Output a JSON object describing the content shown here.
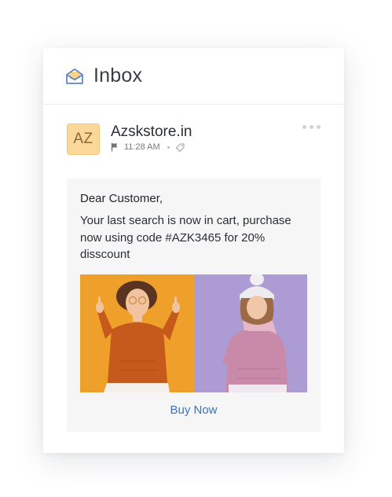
{
  "header": {
    "title": "Inbox",
    "icon": "mail-open-icon"
  },
  "email": {
    "avatar_initials": "AZ",
    "sender": "Azskstore.in",
    "time": "11:28 AM",
    "greeting": "Dear Customer,",
    "body": "Your last search is now in cart, purchase now using code #AZK3465 for 20% disscount",
    "cta_label": "Buy Now"
  },
  "colors": {
    "accent": "#3d74b6",
    "avatar_bg": "#fbd79a",
    "image_left_bg": "#eea02a",
    "image_right_bg": "#ad9bd3",
    "message_bg": "#f6f6f7"
  }
}
